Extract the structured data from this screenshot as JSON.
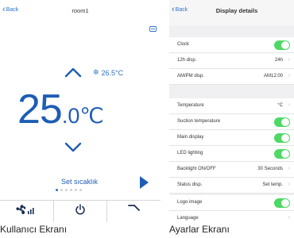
{
  "user_screen": {
    "back_label": "Back",
    "title": "room1",
    "edit_icon": "edit-icon",
    "set_temp_small": "26.5°C",
    "temp_integer": "25",
    "temp_decimal": ".0℃",
    "set_label": "Set sıcaklık",
    "page_dots": 6,
    "active_dot": 1,
    "bottom_icons": [
      "fan-speed-icon",
      "power-icon",
      "swing-icon"
    ]
  },
  "settings_screen": {
    "back_label": "Back",
    "title": "Display details",
    "rows": [
      {
        "label": "Clock",
        "type": "toggle",
        "on": true
      },
      {
        "label": "12h disp.",
        "type": "value",
        "value": "24h"
      },
      {
        "label": "AM/PM disp.",
        "type": "value",
        "value": "AM12:00"
      },
      {
        "label": "Temperature",
        "type": "value",
        "value": "°C"
      },
      {
        "label": "Suction temperature",
        "type": "toggle",
        "on": true
      },
      {
        "label": "Main display",
        "type": "toggle",
        "on": true
      },
      {
        "label": "LED lighting",
        "type": "toggle",
        "on": true
      },
      {
        "label": "Backlight ON/OFF",
        "type": "value",
        "value": "30 Seconds"
      },
      {
        "label": "Status disp.",
        "type": "value",
        "value": "Set temp."
      },
      {
        "label": "Logo image",
        "type": "toggle",
        "on": true
      },
      {
        "label": "Language",
        "type": "value",
        "value": ""
      }
    ]
  },
  "captions": {
    "left": "Kullanıcı Ekranı",
    "right": "Ayarlar Ekranı"
  },
  "colors": {
    "accent": "#1e5db4",
    "link": "#2f6fc4",
    "toggle_on": "#4cd964"
  }
}
